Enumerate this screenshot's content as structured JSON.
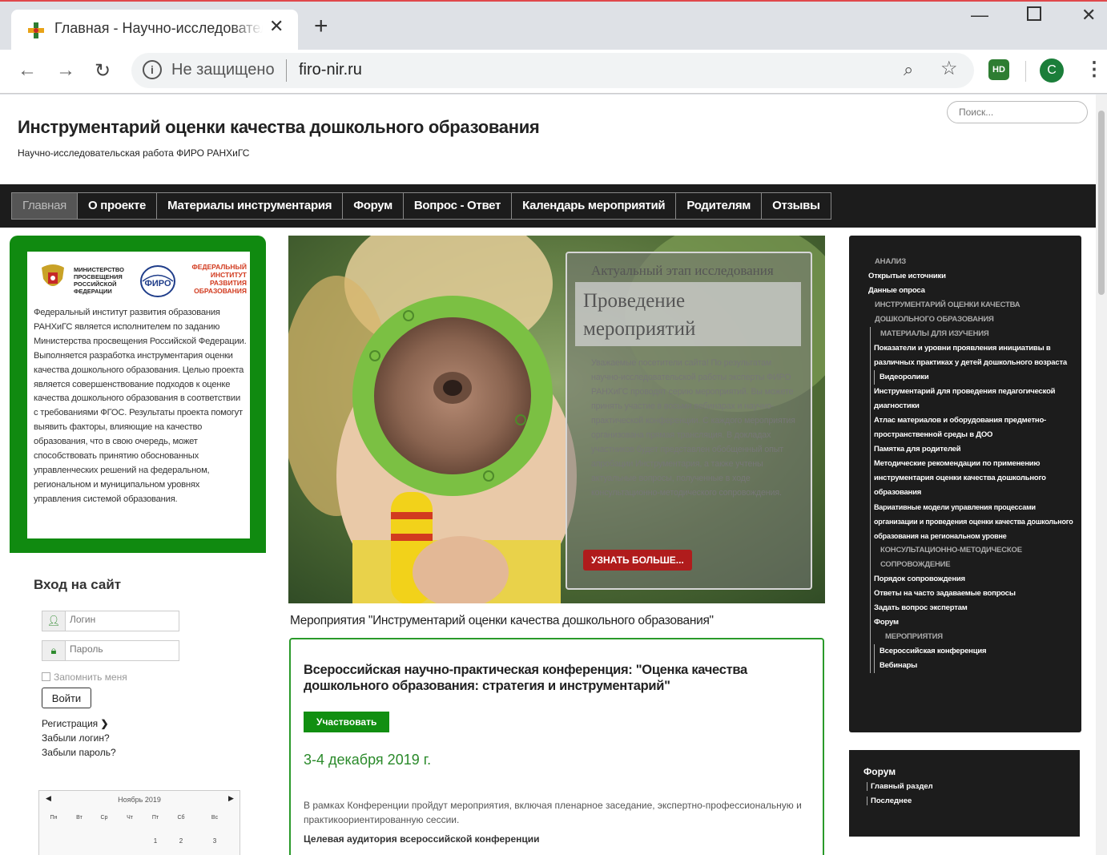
{
  "browser": {
    "tab_title": "Главная - Научно-исследовательская работа",
    "not_secure": "Не защищено",
    "url": "firo-nir.ru",
    "profile_letter": "C",
    "extension_label": "HD"
  },
  "header": {
    "search_placeholder": "Поиск...",
    "title": "Инструментарий оценки качества дошкольного образования",
    "subtitle": "Научно-исследовательская работа ФИРО РАНХиГС"
  },
  "nav": {
    "items": [
      "Главная",
      "О проекте",
      "Материалы инструментария",
      "Форум",
      "Вопрос - Ответ",
      "Календарь мероприятий",
      "Родителям",
      "Отзывы"
    ]
  },
  "intro": {
    "ministry_text": "МИНИСТЕРСТВО ПРОСВЕЩЕНИЯ РОССИЙСКОЙ ФЕДЕРАЦИИ",
    "firo_abbr": "ФИРО",
    "firo_text": "ФЕДЕРАЛЬНЫЙ ИНСТИТУТ РАЗВИТИЯ ОБРАЗОВАНИЯ",
    "text": "Федеральный институт развития образования РАНХиГС является исполнителем по заданию Министерства просвещения Российской Федерации. Выполняется разработка инструментария оценки качества дошкольного образования. Целью проекта является совершенствование подходов к оценке качества дошкольного образования в соответствии с требованиями ФГОС. Результаты проекта помогут выявить факторы, влияющие на качество образования, что в свою очередь, может способствовать принятию обоснованных управленческих решений на федеральном, региональном и муниципальном уровнях управления системой образования."
  },
  "login": {
    "title": "Вход на сайт",
    "login_placeholder": "Логин",
    "password_placeholder": "Пароль",
    "remember": "Запомнить меня",
    "submit": "Войти",
    "register": "Регистрация",
    "forgot_login": "Забыли логин?",
    "forgot_password": "Забыли пароль?"
  },
  "calendar": {
    "month": "Ноябрь 2019",
    "days": [
      "Пн",
      "Вт",
      "Ср",
      "Чт",
      "Пт",
      "Сб",
      "Вс"
    ],
    "first_row": [
      "",
      "",
      "",
      "",
      "1",
      "2",
      "3"
    ]
  },
  "hero": {
    "kicker": "Актуальный этап исследования",
    "title": "Проведение мероприятий",
    "text": "Уважаемые посетители сайта! По результатам научно-исследовательской работы эксперты ФИРО РАНХиГС проводят серию мероприятий. Вы можете принять участие в восьми вебинарах и научно-практической конференции. С каждого мероприятия организована прямая трансляция. В докладах участников будет представлен обобщенный опыт апробации Инструментария, а также учтены актуальные вопросы, полученные в ходе консультационно-методического сопровождения.",
    "button": "УЗНАТЬ БОЛЬШЕ..."
  },
  "events": {
    "heading": "Мероприятия \"Инструментарий оценки качества дошкольного образования\"",
    "card_title": "Всероссийская научно-практическая конференция: \"Оценка качества дошкольного образования: стратегия и инструментарий\"",
    "button": "Участвовать",
    "date": "3-4 декабря 2019 г.",
    "description": "В рамках Конференции пройдут мероприятия, включая пленарное заседание, экспертно-профессиональную и практикоориентированную сессии.",
    "audience": "Целевая аудитория всероссийской конференции"
  },
  "sidebar": {
    "items": [
      {
        "label": "АНАЛИЗ",
        "level": "hdr-l1"
      },
      {
        "label": "Открытые источники",
        "level": "l0"
      },
      {
        "label": "Данные опроса",
        "level": "l0"
      },
      {
        "label": "ИНСТРУМЕНТАРИЙ ОЦЕНКИ КАЧЕСТВА ДОШКОЛЬНОГО ОБРАЗОВАНИЯ",
        "level": "hdr-l1"
      },
      {
        "label": "МАТЕРИАЛЫ ДЛЯ ИЗУЧЕНИЯ",
        "level": "hdr-l2"
      },
      {
        "label": "Показатели и уровни проявления инициативы в различных практиках у детей дошкольного возраста",
        "level": "l3"
      },
      {
        "label": "Видеоролики",
        "level": "l4"
      },
      {
        "label": "Инструментарий для проведения педагогической диагностики",
        "level": "l3"
      },
      {
        "label": "Атлас материалов и оборудования предметно-пространственной среды в ДОО",
        "level": "l3"
      },
      {
        "label": "Памятка для родителей",
        "level": "l3"
      },
      {
        "label": "Методические рекомендации по применению инструментария оценки качества дошкольного образования",
        "level": "l3"
      },
      {
        "label": "Вариативные модели управления процессами организации и проведения оценки качества дошкольного образования на региональном уровне",
        "level": "l3"
      },
      {
        "label": "КОНСУЛЬТАЦИОННО-МЕТОДИЧЕСКОЕ СОПРОВОЖДЕНИЕ",
        "level": "hdr-l2"
      },
      {
        "label": "Порядок сопровождения",
        "level": "l3"
      },
      {
        "label": "Ответы на часто задаваемые вопросы",
        "level": "l3"
      },
      {
        "label": "Задать вопрос экспертам",
        "level": "l3"
      },
      {
        "label": "Форум",
        "level": "l3"
      },
      {
        "label": "МЕРОПРИЯТИЯ",
        "level": "hdr-l3"
      },
      {
        "label": "Всероссийская конференция",
        "level": "l4"
      },
      {
        "label": "Вебинары",
        "level": "l4"
      }
    ]
  },
  "forum_box": {
    "title": "Форум",
    "links": [
      "Главный раздел",
      "Последнее"
    ]
  }
}
